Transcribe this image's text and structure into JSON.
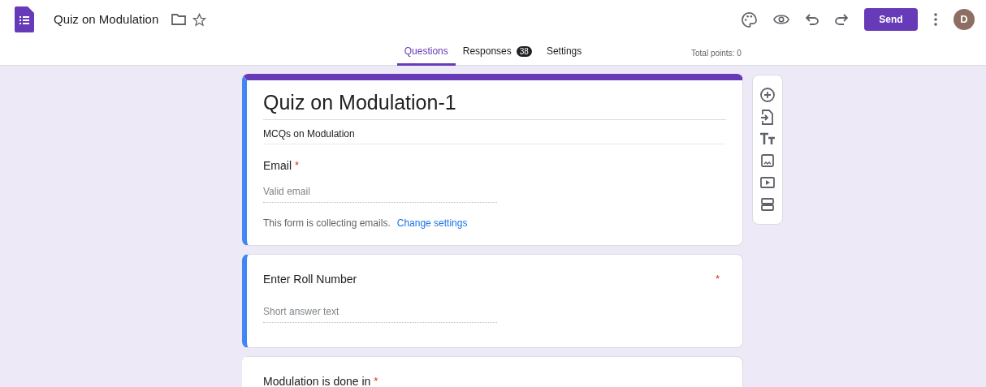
{
  "header": {
    "title": "Quiz on Modulation",
    "send_button": "Send",
    "avatar_letter": "D"
  },
  "tabs": [
    {
      "label": "Questions",
      "selected": true
    },
    {
      "label": "Responses",
      "selected": false,
      "count": "38"
    },
    {
      "label": "Settings",
      "selected": false
    }
  ],
  "total_points": "Total points: 0",
  "form_header": {
    "title": "Quiz on Modulation-1",
    "description": "MCQs on Modulation",
    "highlighted": true,
    "email": {
      "label": "Email",
      "required_mark": "*",
      "placeholder": "Valid email",
      "note": "This form is collecting emails.",
      "link": "Change settings"
    }
  },
  "questions": [
    {
      "title": "Enter Roll Number",
      "required_mark": "*",
      "placeholder": "Short answer text",
      "highlighted": true
    },
    {
      "title": "Modulation is done in",
      "required_mark": "*",
      "highlighted": false
    }
  ]
}
